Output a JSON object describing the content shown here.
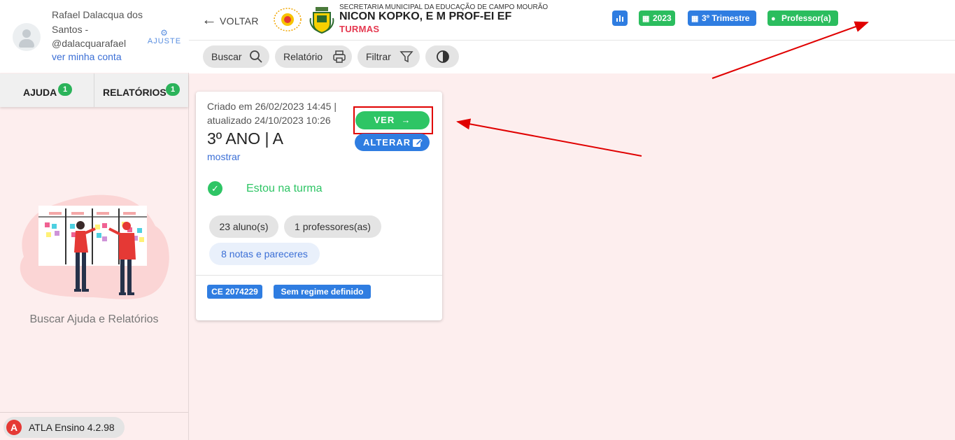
{
  "sidebar": {
    "user": {
      "name": "Rafael Dalacqua dos Santos - @dalacquarafael",
      "account_link": "ver minha conta",
      "settings_label": "AJUSTE"
    },
    "tabs": [
      {
        "label": "AJUDA",
        "badge": "1"
      },
      {
        "label": "RELATÓRIOS",
        "badge": "1"
      }
    ],
    "help_caption": "Buscar Ajuda e Relatórios",
    "version": "ATLA Ensino 4.2.98"
  },
  "header": {
    "back_label": "VOLTAR",
    "org": "SECRETARIA MUNICIPAL DA EDUCAÇÃO DE CAMPO MOURÃO",
    "school": "NICON KOPKO, E M PROF-EI EF",
    "section": "TURMAS",
    "chips": {
      "stats_icon": "bar-chart-icon",
      "year": "2023",
      "term": "3º Trimestre",
      "role": "Professor(a)"
    },
    "colors": {
      "blue": "#2f7de1",
      "green": "#2bbd5e",
      "section_red": "#e53950"
    }
  },
  "toolbar": {
    "search_label": "Buscar",
    "report_label": "Relatório",
    "filter_label": "Filtrar",
    "contrast_icon": "contrast-icon"
  },
  "card": {
    "meta": "Criado em 26/02/2023 14:45 | atualizado 24/10/2023 10:26",
    "title": "3º ANO | A",
    "show_link": "mostrar",
    "view_label": "VER",
    "edit_label": "ALTERAR",
    "membership": "Estou na turma",
    "students": "23 aluno(s)",
    "teachers": "1 professores(as)",
    "grades": "8 notas e pareceres",
    "tags": [
      "CE 2074229",
      "Sem regime definido"
    ]
  }
}
